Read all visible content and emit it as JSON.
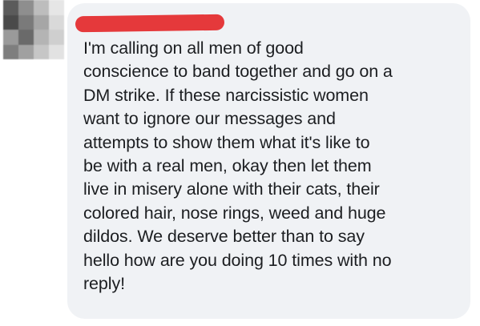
{
  "avatar": {
    "icon": "blurred-profile-avatar-icon",
    "tiles": [
      "#5b5b5b",
      "#8e8e8e",
      "#bdbdbd",
      "#e6e6e6",
      "#4a4a4a",
      "#7a7a7a",
      "#a6a6a6",
      "#d9d9d9",
      "#9a9a9a",
      "#6a6a6a",
      "#b4b4b4",
      "#cfcfcf",
      "#7e7e7e",
      "#a0a0a0",
      "#c6c6c6",
      "#e2e2e2"
    ]
  },
  "comment": {
    "author_redaction_color": "#e5393b",
    "bubble_color": "#f0f2f5",
    "text_color": "#1c1e21",
    "lines": [
      "I'm calling on all men of good",
      "conscience to band together and go on a",
      "DM strike. If these narcissistic women",
      "want to ignore our messages and",
      "attempts to show them what it's like to",
      "be with a real men, okay then let them",
      "live in misery alone with their cats, their",
      "colored hair, nose rings, weed and huge",
      "dildos. We deserve better than to say",
      "hello how are you doing 10 times with no",
      "reply!"
    ]
  }
}
